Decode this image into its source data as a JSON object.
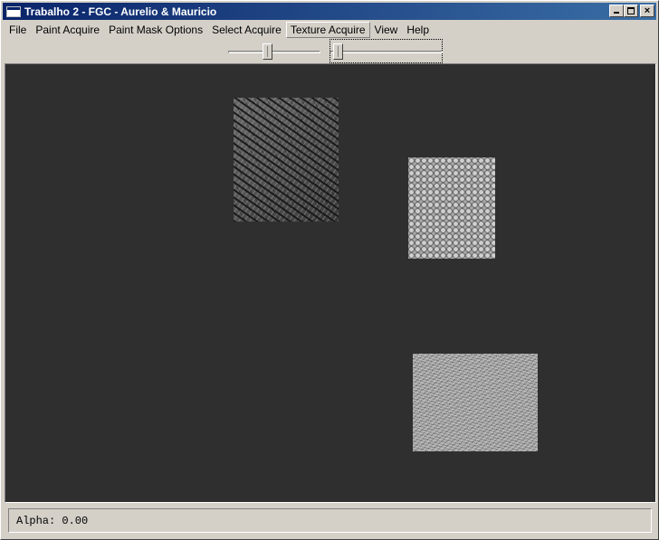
{
  "window": {
    "title": "Trabalho 2 - FGC - Aurelio & Mauricio",
    "icon": "app-window-icon",
    "buttons": {
      "minimize": "_",
      "maximize": "□",
      "close": "×"
    }
  },
  "menubar": {
    "items": [
      "File",
      "Paint Acquire",
      "Paint Mask Options",
      "Select Acquire",
      "Texture Acquire",
      "View",
      "Help"
    ],
    "active": "Texture Acquire"
  },
  "toolbar": {
    "slider1_value": 0.47,
    "slider2_value": 0.0
  },
  "canvas": {
    "background": "#2f2f2f",
    "textures": [
      "rough-diagonal-texture",
      "diamond-pattern-texture",
      "noise-texture"
    ]
  },
  "status": {
    "text": "Alpha: 0.00"
  }
}
